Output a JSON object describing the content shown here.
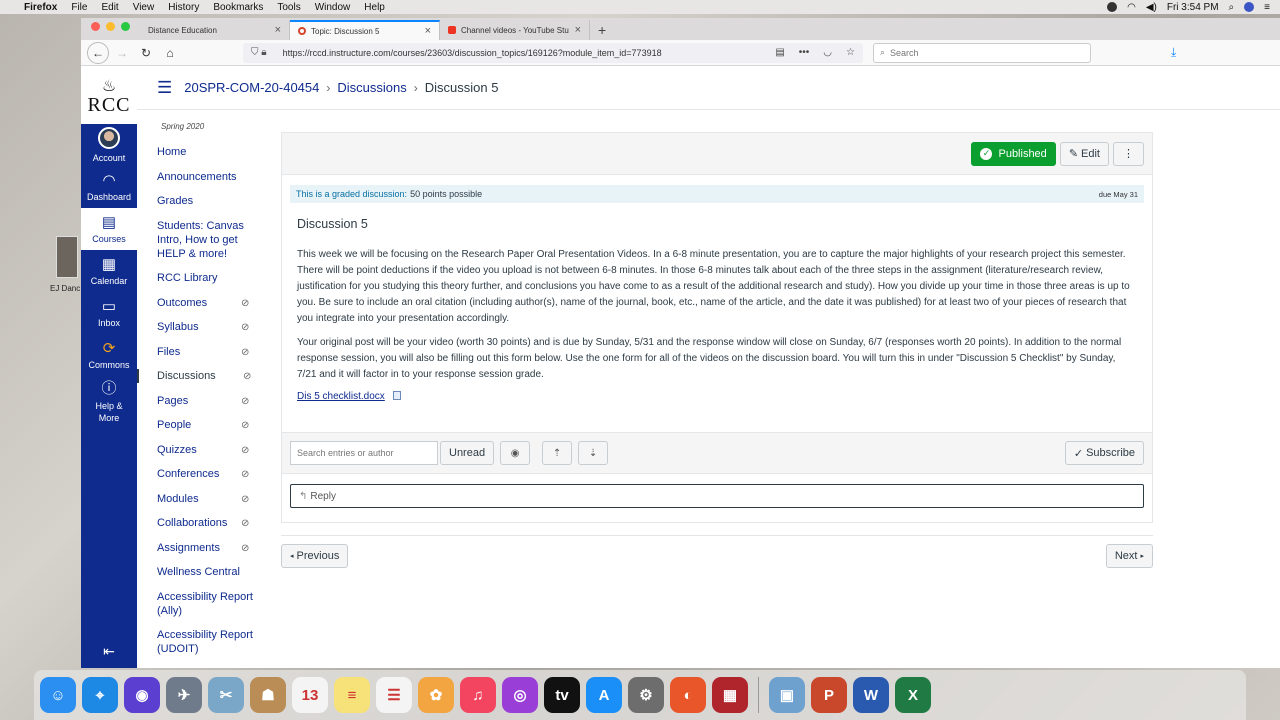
{
  "menubar": {
    "app": "Firefox",
    "items": [
      "File",
      "Edit",
      "View",
      "History",
      "Bookmarks",
      "Tools",
      "Window",
      "Help"
    ],
    "clock": "Fri 3:54 PM"
  },
  "desktop": {
    "icon_label": "EJ Danc"
  },
  "browser": {
    "tabs": [
      {
        "title": "Distance Education"
      },
      {
        "title": "Topic: Discussion 5"
      },
      {
        "title": "Channel videos - YouTube Stu"
      }
    ],
    "url": "https://rccd.instructure.com/courses/23603/discussion_topics/169126?module_item_id=773918",
    "search_placeholder": "Search"
  },
  "global_nav": {
    "logo_text": "RCC",
    "items": [
      {
        "label": "Account"
      },
      {
        "label": "Dashboard"
      },
      {
        "label": "Courses"
      },
      {
        "label": "Calendar"
      },
      {
        "label": "Inbox"
      },
      {
        "label": "Commons"
      },
      {
        "label": "Help & More"
      }
    ]
  },
  "breadcrumb": {
    "course": "20SPR-COM-20-40454",
    "section": "Discussions",
    "current": "Discussion 5"
  },
  "course_nav": {
    "term": "Spring 2020",
    "items": [
      {
        "label": "Home"
      },
      {
        "label": "Announcements"
      },
      {
        "label": "Grades"
      },
      {
        "label": "Students: Canvas Intro, How to get HELP & more!"
      },
      {
        "label": "RCC Library"
      },
      {
        "label": "Outcomes"
      },
      {
        "label": "Syllabus"
      },
      {
        "label": "Files"
      },
      {
        "label": "Discussions"
      },
      {
        "label": "Pages"
      },
      {
        "label": "People"
      },
      {
        "label": "Quizzes"
      },
      {
        "label": "Conferences"
      },
      {
        "label": "Modules"
      },
      {
        "label": "Collaborations"
      },
      {
        "label": "Assignments"
      },
      {
        "label": "Wellness Central"
      },
      {
        "label": "Accessibility Report (Ally)"
      },
      {
        "label": "Accessibility Report (UDOIT)"
      }
    ]
  },
  "toolbar": {
    "published_label": "Published",
    "edit_label": "Edit",
    "more_label": "⋮"
  },
  "discussion": {
    "graded_label": "This is a graded discussion:",
    "points": "50 points possible",
    "due": "due May 31",
    "title": "Discussion 5",
    "para1": "This week we will be focusing on the Research Paper Oral Presentation Videos.  In a 6-8 minute presentation, you are to capture the major highlights of your research project this semester.  There will be point deductions if the video you upload is not between 6-8 minutes.  In those 6-8 minutes talk about each of the three steps in the assignment (literature/research review, justification for you studying this theory further, and conclusions you have come to as a result of the additional research and study).  How you divide up your time in those three areas is up to you.  Be sure to include an oral citation (including author(s), name of the journal, book, etc., name of the article, and the date it was published) for at least two of your pieces of research that you integrate into your presentation accordingly.",
    "para2": "Your original post will be your video (worth 30 points) and is due by Sunday, 5/31 and the response window will close on Sunday, 6/7 (responses worth 20 points). In addition to the normal response session, you will also be filling out this form below.  Use the one form for all of the videos on the discussion board.  You will turn this in under \"Discussion 5 Checklist\" by Sunday, 7/21 and it will factor in to your response session grade.",
    "attachment": "Dis 5 checklist.docx"
  },
  "filters": {
    "search_placeholder": "Search entries or author",
    "unread_label": "Unread",
    "subscribe_label": "Subscribe"
  },
  "reply": {
    "label": "Reply"
  },
  "pager": {
    "previous": "Previous",
    "next": "Next"
  },
  "dock": {
    "apps": [
      {
        "name": "Finder",
        "color": "#2a8ff0",
        "glyph": "☺"
      },
      {
        "name": "Safari",
        "color": "#1e88e5",
        "glyph": "⌖"
      },
      {
        "name": "Siri",
        "color": "#5b3fd1",
        "glyph": "◉"
      },
      {
        "name": "Launchpad",
        "color": "#6f7b8a",
        "glyph": "✈"
      },
      {
        "name": "Preview",
        "color": "#7aa6c7",
        "glyph": "✂"
      },
      {
        "name": "Contacts",
        "color": "#b98d55",
        "glyph": "☗"
      },
      {
        "name": "Calendar",
        "color": "#f4f4f4",
        "glyph": "13"
      },
      {
        "name": "Notes",
        "color": "#f7e27a",
        "glyph": "≡"
      },
      {
        "name": "Reminders",
        "color": "#f4f4f4",
        "glyph": "☰"
      },
      {
        "name": "Photos",
        "color": "#f2a541",
        "glyph": "✿"
      },
      {
        "name": "Music",
        "color": "#f3455f",
        "glyph": "♫"
      },
      {
        "name": "Podcasts",
        "color": "#9a3ed8",
        "glyph": "◎"
      },
      {
        "name": "TV",
        "color": "#111111",
        "glyph": "tv"
      },
      {
        "name": "App Store",
        "color": "#1a8ff7",
        "glyph": "A"
      },
      {
        "name": "System Preferences",
        "color": "#6d6d6d",
        "glyph": "⚙"
      },
      {
        "name": "Firefox",
        "color": "#e8562a",
        "glyph": "◐"
      },
      {
        "name": "Photo Booth",
        "color": "#b0242c",
        "glyph": "▦"
      },
      {
        "name": "Preview 2",
        "color": "#6fa1cf",
        "glyph": "▣"
      },
      {
        "name": "PowerPoint",
        "color": "#c9472a",
        "glyph": "P"
      },
      {
        "name": "Word",
        "color": "#2a5ab0",
        "glyph": "W"
      },
      {
        "name": "Excel",
        "color": "#1f7a43",
        "glyph": "X"
      }
    ]
  }
}
